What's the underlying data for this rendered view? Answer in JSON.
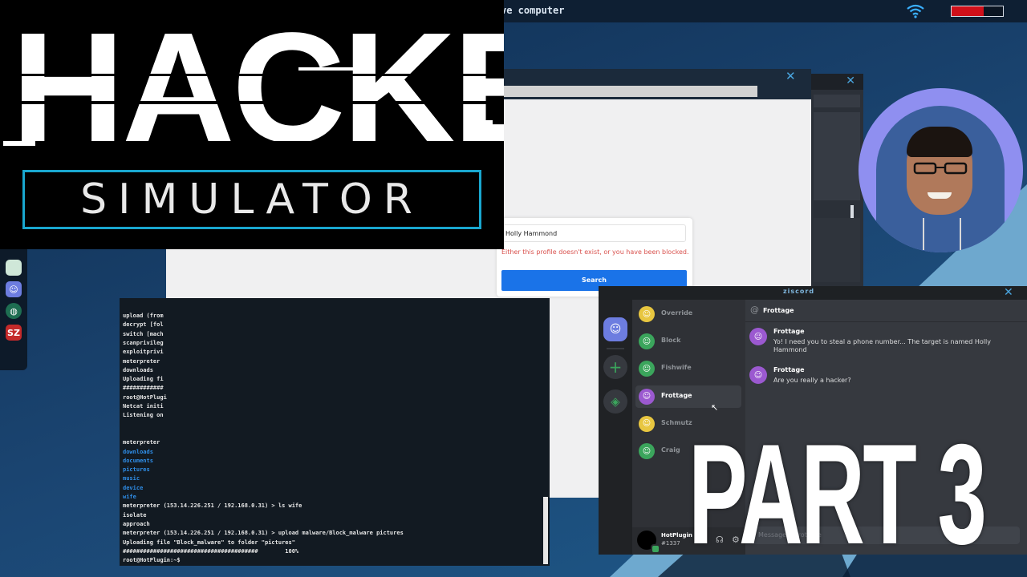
{
  "topbar": {
    "title": "ve computer",
    "battery_level": 0.62,
    "battery_color": "#d0101a"
  },
  "logo": {
    "title": "HACKER",
    "subtitle": "SIMULATOR",
    "accent": "#19a7cf"
  },
  "dock": {
    "icons": [
      "notes-icon",
      "ziscord-icon",
      "globe-icon",
      "sz-icon"
    ],
    "sz_label": "SZ"
  },
  "profile_search": {
    "input_value": "Holly Hammond",
    "error": "Either this profile doesn't exist, or you have been blocked.",
    "button": "Search"
  },
  "terminal": {
    "lines": [
      "upload (from",
      "decrypt [fol",
      "switch [mach",
      "scanprivileg",
      "exploitprivi",
      "meterpreter",
      "downloads",
      "Uploading fi",
      "############",
      "root@HotPlugi",
      "Netcat initi",
      "Listening on",
      "",
      "",
      "meterpreter",
      "downloads",
      "documents",
      "pictures",
      "music",
      "device",
      "wife",
      "meterpreter (153.14.226.251 / 192.168.0.31) > ls wife",
      "isolate",
      "approach",
      "meterpreter (153.14.226.251 / 192.168.0.31) > upload malware/Block_malware pictures",
      "Uploading file \"Block_malware\" to folder \"pictures\"",
      "########################################        100%",
      "root@HotPlugin:~$"
    ]
  },
  "ziscord": {
    "title": "ziscord",
    "contacts": [
      {
        "name": "Override",
        "color": "#e8c640"
      },
      {
        "name": "Block",
        "color": "#3ba55c"
      },
      {
        "name": "Fishwife",
        "color": "#3ba55c"
      },
      {
        "name": "Frottage",
        "color": "#9b59d0"
      },
      {
        "name": "Schmutz",
        "color": "#e8c640"
      },
      {
        "name": "Craig",
        "color": "#3ba55c"
      }
    ],
    "selected": "Frottage",
    "header": "Frottage",
    "messages": [
      {
        "author": "Frottage",
        "text": "Yo! I need you to steal a phone number... The target is named Holly Hammond"
      },
      {
        "author": "Frottage",
        "text": "Are you really a hacker?"
      }
    ],
    "user": {
      "name": "HotPlugin",
      "tag": "#1337"
    },
    "input_placeholder": "Message @Frottage"
  },
  "overlay": {
    "part": "PART 3"
  }
}
